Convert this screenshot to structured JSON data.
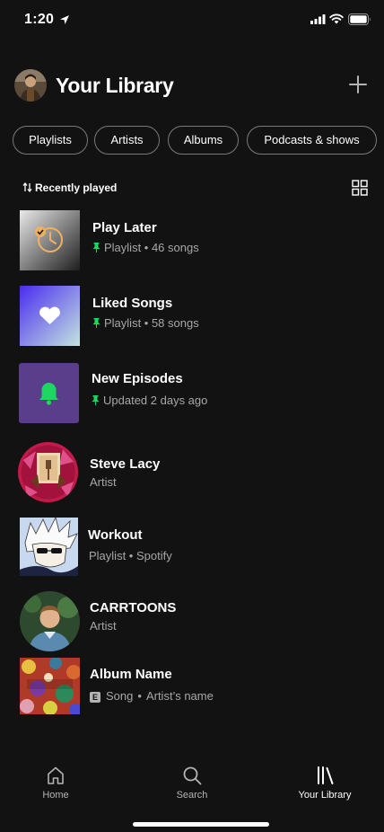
{
  "status_bar": {
    "time": "1:20",
    "location_icon": "location-arrow-icon",
    "signal_icon": "cellular-signal-icon",
    "wifi_icon": "wifi-icon",
    "battery_icon": "battery-icon"
  },
  "header": {
    "title": "Your Library",
    "avatar_icon": "profile-avatar",
    "add_icon": "plus-icon"
  },
  "filters": [
    {
      "label": "Playlists"
    },
    {
      "label": "Artists"
    },
    {
      "label": "Albums"
    },
    {
      "label": "Podcasts & shows"
    }
  ],
  "sort": {
    "label": "Recently played",
    "sort_icon": "sort-arrows-icon",
    "view_icon": "grid-view-icon"
  },
  "library_items": [
    {
      "title": "Play Later",
      "subtitle": "Playlist • 46 songs",
      "pinned": true,
      "kind": "playlist",
      "art": "clock-icon"
    },
    {
      "title": "Liked Songs",
      "subtitle": "Playlist • 58 songs",
      "pinned": true,
      "kind": "playlist",
      "art": "heart-icon"
    },
    {
      "title": "New Episodes",
      "subtitle": "Updated 2 days ago",
      "pinned": true,
      "kind": "collection",
      "art": "bell-icon"
    },
    {
      "title": "Steve Lacy",
      "subtitle": "Artist",
      "pinned": false,
      "kind": "artist",
      "art": "artist-photo"
    },
    {
      "title": "Workout",
      "subtitle": "Playlist • Spotify",
      "pinned": false,
      "kind": "playlist",
      "art": "anime-cover-art"
    },
    {
      "title": "CARRTOONS",
      "subtitle": "Artist",
      "pinned": false,
      "kind": "artist",
      "art": "artist-photo"
    },
    {
      "title": "Album Name",
      "subtitle_type": "Song",
      "subtitle_artist": "Artist’s name",
      "explicit": true,
      "explicit_label": "E",
      "kind": "album",
      "art": "album-cover-art"
    }
  ],
  "bottom_nav": [
    {
      "label": "Home",
      "icon": "home-icon",
      "active": false
    },
    {
      "label": "Search",
      "icon": "search-icon",
      "active": false
    },
    {
      "label": "Your Library",
      "icon": "library-icon",
      "active": true
    }
  ],
  "colors": {
    "background": "#121212",
    "accent_green": "#1ed760",
    "secondary_text": "#a7a7a7",
    "chip_border": "#7a7a7a",
    "new_episodes_bg": "#5a3e8c",
    "liked_songs_gradient_start": "#4a2cf0",
    "liked_songs_gradient_end": "#c4e4e0"
  }
}
